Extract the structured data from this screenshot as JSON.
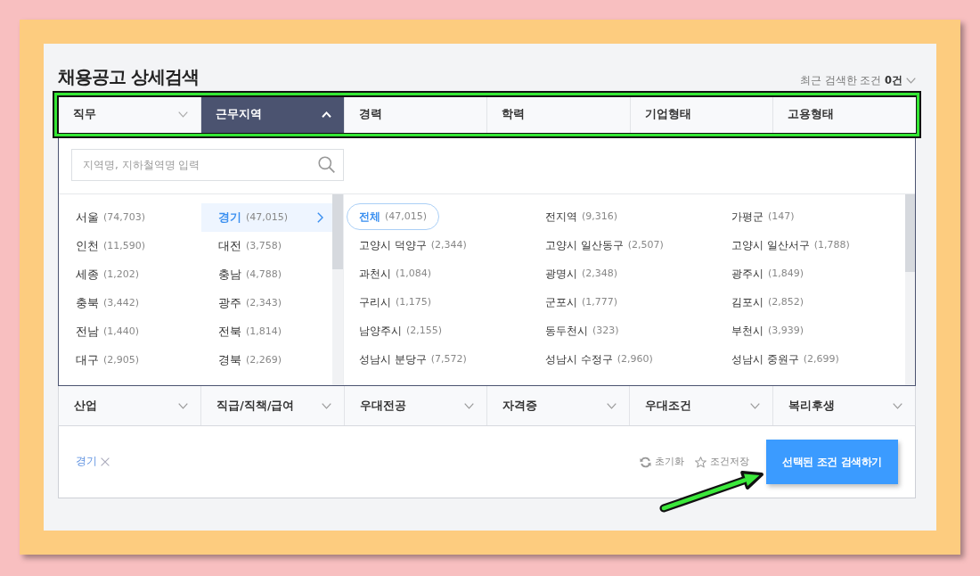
{
  "title": "채용공고 상세검색",
  "recent_searches": {
    "label": "최근 검색한 조건 **0건**"
  },
  "tabs": [
    {
      "label": "직무",
      "selected": false,
      "dropdown": true
    },
    {
      "label": "근무지역",
      "selected": true,
      "dropdown": true
    },
    {
      "label": "경력",
      "selected": false,
      "dropdown": false
    },
    {
      "label": "학력",
      "selected": false,
      "dropdown": false
    },
    {
      "label": "기업형태",
      "selected": false,
      "dropdown": false
    },
    {
      "label": "고용형태",
      "selected": false,
      "dropdown": false
    }
  ],
  "region_panel": {
    "search": {
      "placeholder": "지역명, 지하철역명 입력"
    },
    "provinces": [
      {
        "name": "서울",
        "count": "(74,703)",
        "selected": false
      },
      {
        "name": "경기",
        "count": "(47,015)",
        "selected": true
      },
      {
        "name": "인천",
        "count": "(11,590)",
        "selected": false
      },
      {
        "name": "대전",
        "count": "(3,758)",
        "selected": false
      },
      {
        "name": "세종",
        "count": "(1,202)",
        "selected": false
      },
      {
        "name": "충남",
        "count": "(4,788)",
        "selected": false
      },
      {
        "name": "충북",
        "count": "(3,442)",
        "selected": false
      },
      {
        "name": "광주",
        "count": "(2,343)",
        "selected": false
      },
      {
        "name": "전남",
        "count": "(1,440)",
        "selected": false
      },
      {
        "name": "전북",
        "count": "(1,814)",
        "selected": false
      },
      {
        "name": "대구",
        "count": "(2,905)",
        "selected": false
      },
      {
        "name": "경북",
        "count": "(2,269)",
        "selected": false
      }
    ],
    "districts": [
      {
        "name": "전체",
        "count": "(47,015)",
        "selected": true
      },
      {
        "name": "전지역",
        "count": "(9,316)",
        "selected": false
      },
      {
        "name": "가평군",
        "count": "(147)",
        "selected": false
      },
      {
        "name": "고양시 덕양구",
        "count": "(2,344)",
        "selected": false
      },
      {
        "name": "고양시 일산동구",
        "count": "(2,507)",
        "selected": false
      },
      {
        "name": "고양시 일산서구",
        "count": "(1,788)",
        "selected": false
      },
      {
        "name": "과천시",
        "count": "(1,084)",
        "selected": false
      },
      {
        "name": "광명시",
        "count": "(2,348)",
        "selected": false
      },
      {
        "name": "광주시",
        "count": "(1,849)",
        "selected": false
      },
      {
        "name": "구리시",
        "count": "(1,175)",
        "selected": false
      },
      {
        "name": "군포시",
        "count": "(1,777)",
        "selected": false
      },
      {
        "name": "김포시",
        "count": "(2,852)",
        "selected": false
      },
      {
        "name": "남양주시",
        "count": "(2,155)",
        "selected": false
      },
      {
        "name": "동두천시",
        "count": "(323)",
        "selected": false
      },
      {
        "name": "부천시",
        "count": "(3,939)",
        "selected": false
      },
      {
        "name": "성남시 분당구",
        "count": "(7,572)",
        "selected": false
      },
      {
        "name": "성남시 수정구",
        "count": "(2,960)",
        "selected": false
      },
      {
        "name": "성남시 중원구",
        "count": "(2,699)",
        "selected": false
      }
    ]
  },
  "more_filters": [
    "산업",
    "직급/직책/급여",
    "우대전공",
    "자격증",
    "우대조건",
    "복리후생"
  ],
  "selected_conditions": [
    {
      "label": "경기"
    }
  ],
  "actions": {
    "reset": "초기화",
    "save": "조건저장",
    "search": "선택된 조건 검색하기"
  },
  "annotations": {
    "tab_highlight": true,
    "arrow": true
  }
}
